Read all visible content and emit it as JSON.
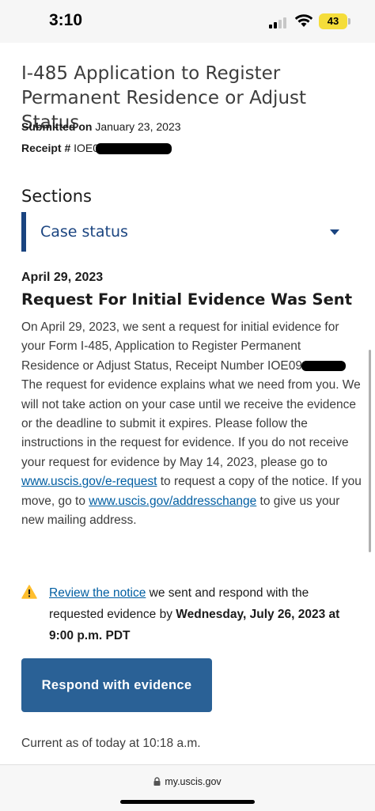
{
  "status_bar": {
    "time": "3:10",
    "battery_level": "43",
    "battery_color": "#f5dd3a"
  },
  "header": {
    "title": "I-485 Application to Register Permanent Residence or Adjust Status",
    "submitted_label": "Submitted on",
    "submitted_date": "January 23, 2023",
    "receipt_label": "Receipt #",
    "receipt_prefix": "IOE0"
  },
  "sections": {
    "label": "Sections",
    "selected": "Case status"
  },
  "case_status": {
    "date": "April 29, 2023",
    "heading": "Request For Initial Evidence Was Sent",
    "body": {
      "part1": "On April 29, 2023, we sent a request for initial evidence for your Form I-485, Application to Register Permanent Residence or Adjust Status, Receipt Number IOE09",
      "part2": " The request for evidence explains what we need from you. We will not take action on your case until we receive the evidence or the deadline to submit it expires. Please follow the instructions in the request for evidence. If you do not receive your request for evidence by May 14, 2023, please go to ",
      "link1": "www.uscis.gov/e-request",
      "part3": " to request a copy of the notice. If you move, go to ",
      "link2": "www.uscis.gov/addresschange",
      "part4": " to give us your new mailing address."
    }
  },
  "alert": {
    "icon": "warning-icon",
    "link_text": "Review the notice",
    "text": " we sent and respond with the requested evidence by ",
    "deadline": "Wednesday, July 26, 2023 at 9:00 p.m. PDT"
  },
  "actions": {
    "respond_button": "Respond with evidence",
    "button_color": "#2a6196"
  },
  "footer": {
    "current_as_of": "Current as of today at 10:18 a.m."
  },
  "browser": {
    "url": "my.uscis.gov"
  }
}
